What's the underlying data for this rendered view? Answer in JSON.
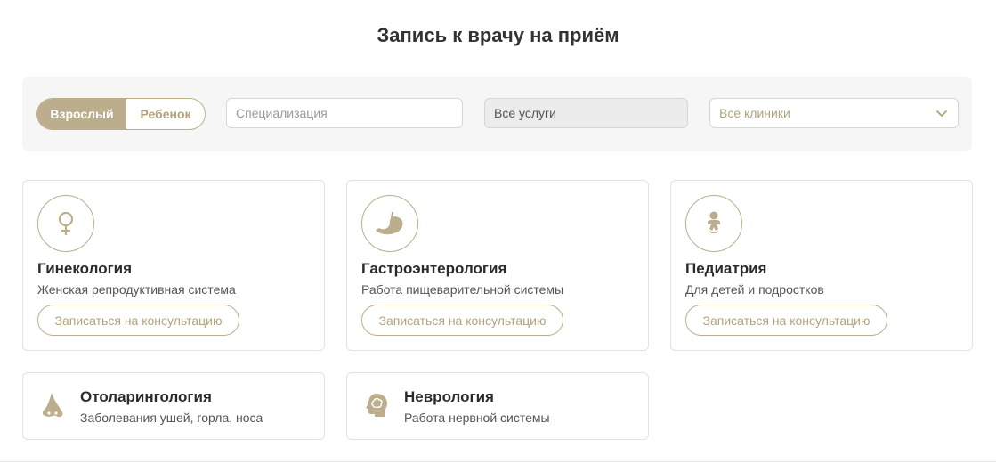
{
  "page": {
    "title": "Запись к врачу на приём"
  },
  "filters": {
    "toggle": {
      "adult": "Взрослый",
      "child": "Ребенок",
      "selected": "adult"
    },
    "specialization_placeholder": "Специализация",
    "services_value": "Все услуги",
    "clinics_value": "Все клиники"
  },
  "colors": {
    "accent": "#bcae8c",
    "accent_text": "#b2a37c",
    "border": "#e3e3e3",
    "bar_bg": "#f6f6f6"
  },
  "specialties": [
    {
      "title": "Гинекология",
      "subtitle": "Женская репродуктивная система",
      "button": "Записаться на консультацию",
      "icon": "female-symbol-icon"
    },
    {
      "title": "Гастроэнтерология",
      "subtitle": "Работа пищеварительной системы",
      "button": "Записаться на консультацию",
      "icon": "stomach-icon"
    },
    {
      "title": "Педиатрия",
      "subtitle": "Для детей и подростков",
      "button": "Записаться на консультацию",
      "icon": "baby-icon"
    },
    {
      "title": "Отоларингология",
      "subtitle": "Заболевания ушей, горла, носа",
      "icon": "nose-icon"
    },
    {
      "title": "Неврология",
      "subtitle": "Работа нервной системы",
      "icon": "brain-head-icon"
    }
  ]
}
